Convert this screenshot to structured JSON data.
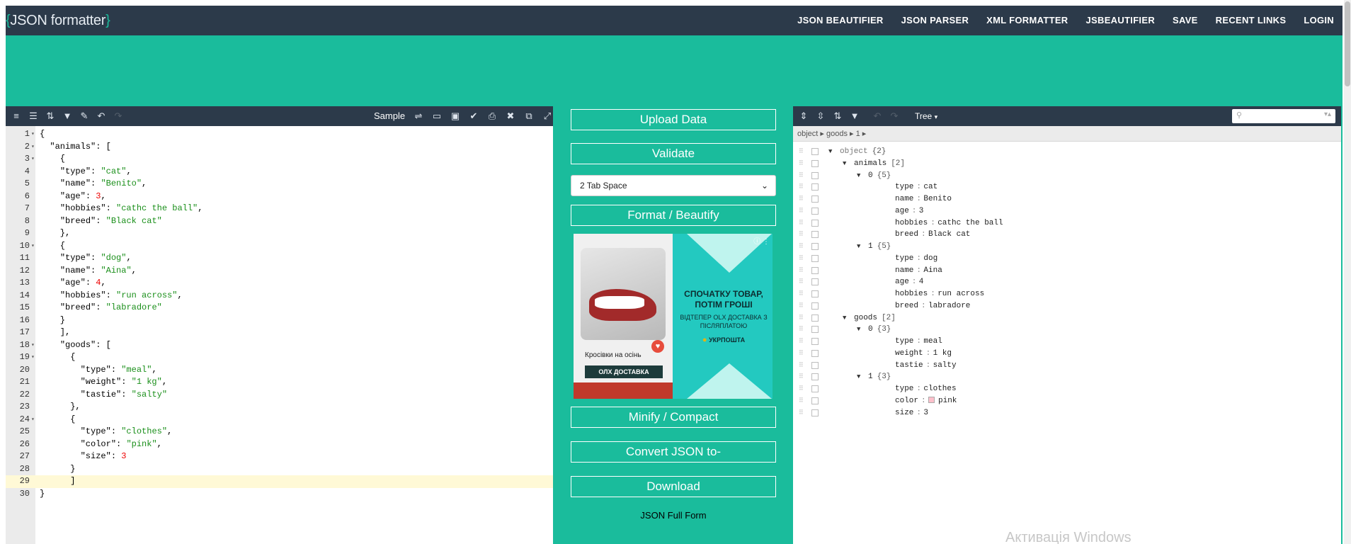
{
  "app": {
    "brace_open": "{",
    "name": "JSON formatter",
    "brace_close": "}"
  },
  "nav": [
    "JSON BEAUTIFIER",
    "JSON PARSER",
    "XML FORMATTER",
    "JSBEAUTIFIER",
    "SAVE",
    "RECENT LINKS",
    "LOGIN"
  ],
  "editor": {
    "sample_label": "Sample",
    "lines": [
      {
        "n": "1",
        "fold": true,
        "html": "{"
      },
      {
        "n": "2",
        "fold": true,
        "html": "  <span class='k'>\"animals\"</span>: ["
      },
      {
        "n": "3",
        "fold": true,
        "html": "    {"
      },
      {
        "n": "4",
        "fold": false,
        "html": "    <span class='k'>\"type\"</span>: <span class='s'>\"cat\"</span>,"
      },
      {
        "n": "5",
        "fold": false,
        "html": "    <span class='k'>\"name\"</span>: <span class='s'>\"Benito\"</span>,"
      },
      {
        "n": "6",
        "fold": false,
        "html": "    <span class='k'>\"age\"</span>: <span class='n'>3</span>,"
      },
      {
        "n": "7",
        "fold": false,
        "html": "    <span class='k'>\"hobbies\"</span>: <span class='s'>\"cathc the ball\"</span>,"
      },
      {
        "n": "8",
        "fold": false,
        "html": "    <span class='k'>\"breed\"</span>: <span class='s'>\"Black cat\"</span>"
      },
      {
        "n": "9",
        "fold": false,
        "html": "    },"
      },
      {
        "n": "10",
        "fold": true,
        "html": "    {"
      },
      {
        "n": "11",
        "fold": false,
        "html": "    <span class='k'>\"type\"</span>: <span class='s'>\"dog\"</span>,"
      },
      {
        "n": "12",
        "fold": false,
        "html": "    <span class='k'>\"name\"</span>: <span class='s'>\"Aina\"</span>,"
      },
      {
        "n": "13",
        "fold": false,
        "html": "    <span class='k'>\"age\"</span>: <span class='n'>4</span>,"
      },
      {
        "n": "14",
        "fold": false,
        "html": "    <span class='k'>\"hobbies\"</span>: <span class='s'>\"run across\"</span>,"
      },
      {
        "n": "15",
        "fold": false,
        "html": "    <span class='k'>\"breed\"</span>: <span class='s'>\"labradore\"</span>"
      },
      {
        "n": "16",
        "fold": false,
        "html": "    }"
      },
      {
        "n": "17",
        "fold": false,
        "html": "    ],"
      },
      {
        "n": "18",
        "fold": true,
        "html": "    <span class='k'>\"goods\"</span>: ["
      },
      {
        "n": "19",
        "fold": true,
        "html": "      {"
      },
      {
        "n": "20",
        "fold": false,
        "html": "        <span class='k'>\"type\"</span>: <span class='s'>\"meal\"</span>,"
      },
      {
        "n": "21",
        "fold": false,
        "html": "        <span class='k'>\"weight\"</span>: <span class='s'>\"1 kg\"</span>,"
      },
      {
        "n": "22",
        "fold": false,
        "html": "        <span class='k'>\"tastie\"</span>: <span class='s'>\"salty\"</span>"
      },
      {
        "n": "23",
        "fold": false,
        "html": "      },"
      },
      {
        "n": "24",
        "fold": true,
        "html": "      {"
      },
      {
        "n": "25",
        "fold": false,
        "html": "        <span class='k'>\"type\"</span>: <span class='s'>\"clothes\"</span>,"
      },
      {
        "n": "26",
        "fold": false,
        "html": "        <span class='k'>\"color\"</span>: <span class='s'>\"pink\"</span>,"
      },
      {
        "n": "27",
        "fold": false,
        "html": "        <span class='k'>\"size\"</span>: <span class='n'>3</span>"
      },
      {
        "n": "28",
        "fold": false,
        "html": "      }"
      },
      {
        "n": "29",
        "fold": false,
        "html": "      ]"
      },
      {
        "n": "30",
        "fold": false,
        "html": "}"
      }
    ]
  },
  "middle": {
    "upload": "Upload Data",
    "validate": "Validate",
    "tab_space": "2 Tab Space",
    "format": "Format / Beautify",
    "minify": "Minify / Compact",
    "convert": "Convert JSON to-",
    "download": "Download",
    "full_form": "JSON Full Form",
    "ad": {
      "caption": "Кросівки на осінь",
      "olx_button": "ОЛХ ДОСТАВКА",
      "headline": "СПОЧАТКУ ТОВАР, ПОТІМ ГРОШІ",
      "sub": "ВІДТЕПЕР OLX ДОСТАВКА З ПІСЛЯПЛАТОЮ",
      "brand": "УКРПОШТА"
    }
  },
  "tree": {
    "mode": "Tree",
    "breadcrumb": "object ▸ goods ▸ 1 ▸",
    "rows": [
      {
        "indent": 0,
        "tri": true,
        "key": "object",
        "meta": "{2}"
      },
      {
        "indent": 1,
        "tri": true,
        "key": "animals",
        "meta": "[2]"
      },
      {
        "indent": 2,
        "tri": true,
        "key": "0",
        "meta": "{5}"
      },
      {
        "indent": 3,
        "key": "type",
        "val": "cat"
      },
      {
        "indent": 3,
        "key": "name",
        "val": "Benito"
      },
      {
        "indent": 3,
        "key": "age",
        "val": "3"
      },
      {
        "indent": 3,
        "key": "hobbies",
        "val": "cathc the ball"
      },
      {
        "indent": 3,
        "key": "breed",
        "val": "Black cat"
      },
      {
        "indent": 2,
        "tri": true,
        "key": "1",
        "meta": "{5}"
      },
      {
        "indent": 3,
        "key": "type",
        "val": "dog"
      },
      {
        "indent": 3,
        "key": "name",
        "val": "Aina"
      },
      {
        "indent": 3,
        "key": "age",
        "val": "4"
      },
      {
        "indent": 3,
        "key": "hobbies",
        "val": "run across"
      },
      {
        "indent": 3,
        "key": "breed",
        "val": "labradore"
      },
      {
        "indent": 1,
        "tri": true,
        "key": "goods",
        "meta": "[2]"
      },
      {
        "indent": 2,
        "tri": true,
        "key": "0",
        "meta": "{3}"
      },
      {
        "indent": 3,
        "key": "type",
        "val": "meal"
      },
      {
        "indent": 3,
        "key": "weight",
        "val": "1 kg"
      },
      {
        "indent": 3,
        "key": "tastie",
        "val": "salty"
      },
      {
        "indent": 2,
        "tri": true,
        "key": "1",
        "meta": "{3}"
      },
      {
        "indent": 3,
        "key": "type",
        "val": "clothes"
      },
      {
        "indent": 3,
        "key": "color",
        "val": "pink",
        "swatch": true
      },
      {
        "indent": 3,
        "key": "size",
        "val": "3"
      }
    ]
  },
  "watermark": "Активація Windows",
  "colors": {
    "teal": "#1abc9c",
    "navy": "#2c3a4a",
    "string": "#1a8f1a",
    "number": "#e00000"
  }
}
